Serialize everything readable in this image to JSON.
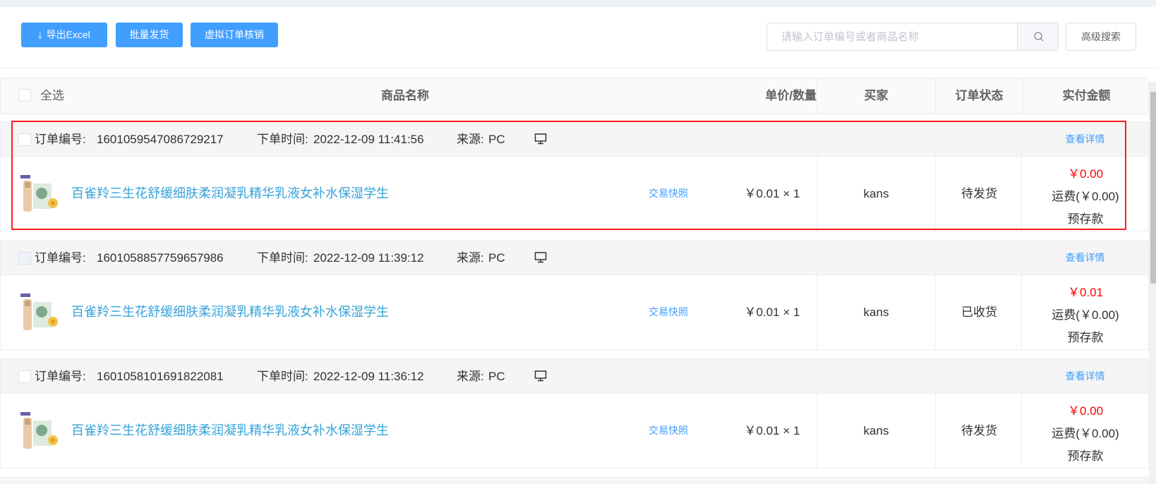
{
  "toolbar": {
    "export_label": "导出Excel",
    "batch_ship_label": "批量发货",
    "virtual_verify_label": "虚拟订单核销",
    "search_placeholder": "请输入订单编号或者商品名称",
    "advanced_search_label": "高级搜索"
  },
  "table": {
    "select_all": "全选",
    "columns": [
      "商品名称",
      "单价/数量",
      "买家",
      "订单状态",
      "实付金额"
    ]
  },
  "orders": [
    {
      "order_no_label": "订单编号:",
      "order_no": "1601059547086729217",
      "time_label": "下单时间:",
      "time": "2022-12-09 11:41:56",
      "source_label": "来源:",
      "source": "PC",
      "detail_link": "查看详情",
      "product_name": "百雀羚三生花舒缓细肤柔润凝乳精华乳液女补水保湿学生",
      "snapshot": "交易快照",
      "price_qty": "￥0.01 × 1",
      "buyer": "kans",
      "status": "待发货",
      "amount": "￥0.00",
      "freight": "运费(￥0.00)",
      "pay_type": "预存款",
      "icon": "monitor-icon"
    },
    {
      "order_no_label": "订单编号:",
      "order_no": "1601058857759657986",
      "time_label": "下单时间:",
      "time": "2022-12-09 11:39:12",
      "source_label": "来源:",
      "source": "PC",
      "detail_link": "查看详情",
      "product_name": "百雀羚三生花舒缓细肤柔润凝乳精华乳液女补水保湿学生",
      "snapshot": "交易快照",
      "price_qty": "￥0.01 × 1",
      "buyer": "kans",
      "status": "已收货",
      "amount": "￥0.01",
      "freight": "运费(￥0.00)",
      "pay_type": "预存款",
      "icon": "monitor-icon"
    },
    {
      "order_no_label": "订单编号:",
      "order_no": "1601058101691822081",
      "time_label": "下单时间:",
      "time": "2022-12-09 11:36:12",
      "source_label": "来源:",
      "source": "PC",
      "detail_link": "查看详情",
      "product_name": "百雀羚三生花舒缓细肤柔润凝乳精华乳液女补水保湿学生",
      "snapshot": "交易快照",
      "price_qty": "￥0.01 × 1",
      "buyer": "kans",
      "status": "待发货",
      "amount": "￥0.00",
      "freight": "运费(￥0.00)",
      "pay_type": "预存款",
      "icon": "monitor-icon"
    }
  ],
  "colors": {
    "primary": "#409eff",
    "link": "#36a3d9",
    "price_red": "#ff0000",
    "highlight": "#ff1e1e"
  }
}
